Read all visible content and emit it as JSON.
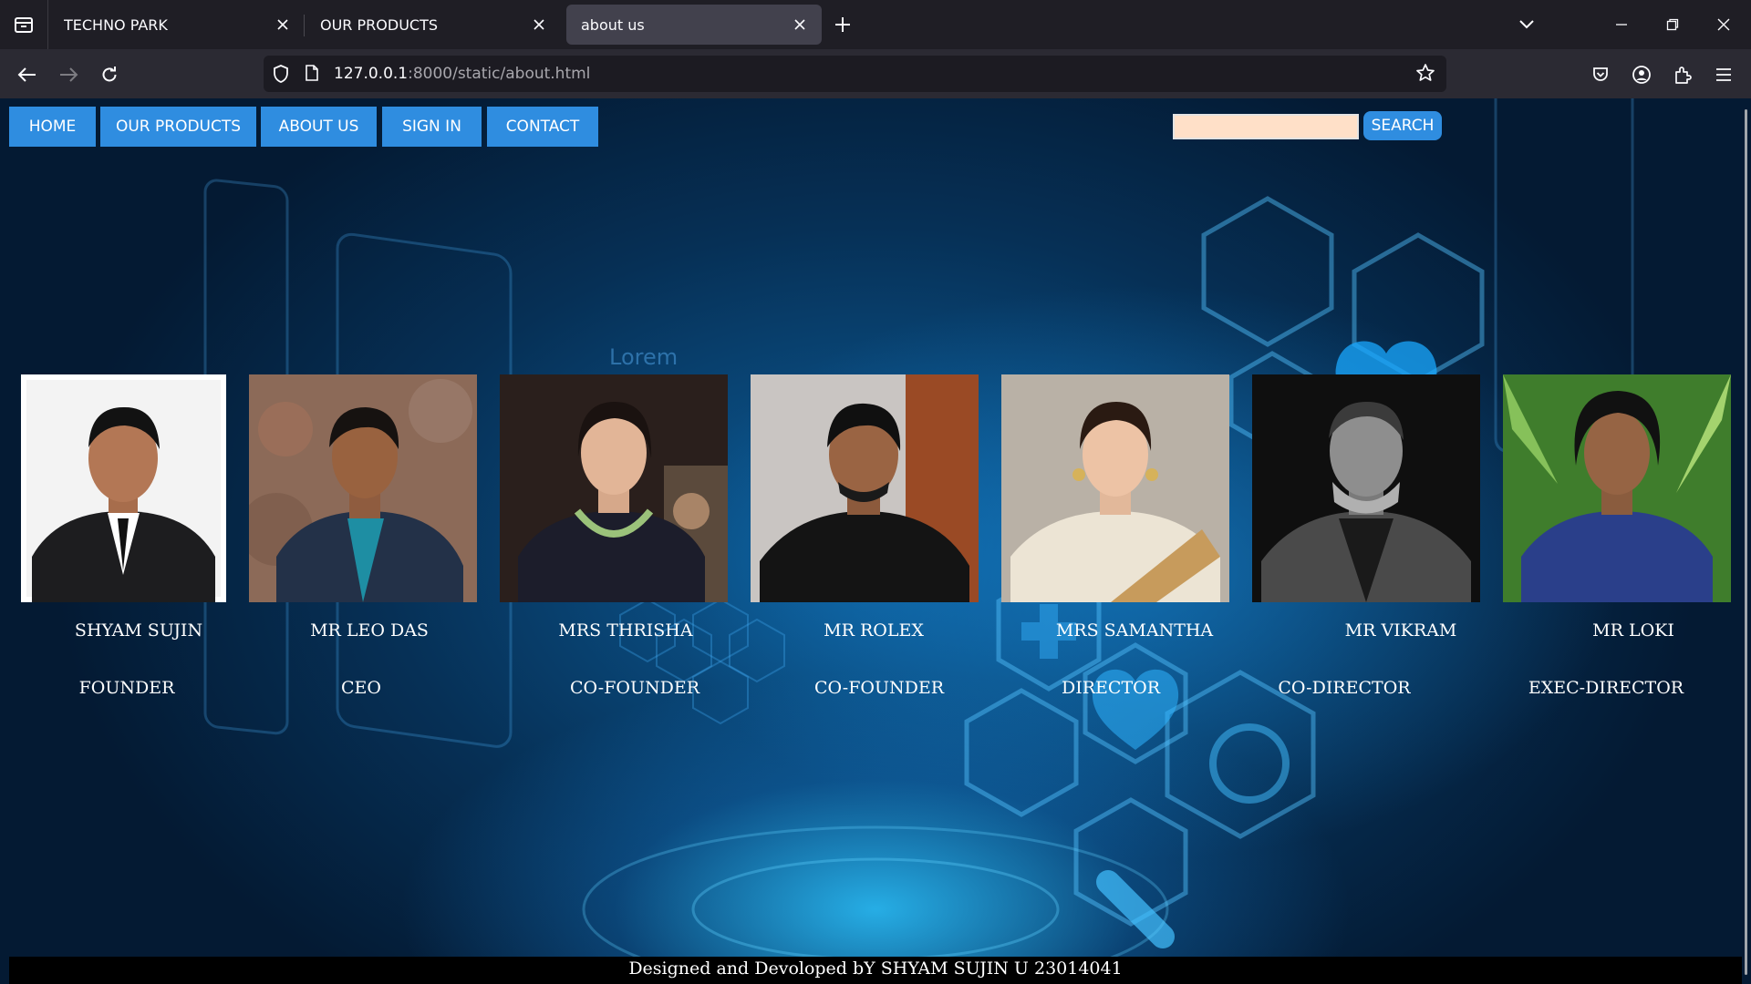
{
  "browser": {
    "tabs": [
      {
        "title": "TECHNO PARK",
        "active": false
      },
      {
        "title": "OUR PRODUCTS",
        "active": false
      },
      {
        "title": "about us",
        "active": true
      }
    ],
    "url_host": "127.0.0.1",
    "url_rest": ":8000/static/about.html"
  },
  "page": {
    "menu": [
      "HOME",
      "OUR PRODUCTS",
      "ABOUT US",
      "SIGN IN",
      "CONTACT"
    ],
    "search": {
      "value": "",
      "button": "SEARCH"
    },
    "background_text": "Lorem",
    "team": [
      {
        "name": "SHYAM SUJIN",
        "role": "FOUNDER"
      },
      {
        "name": "MR LEO DAS",
        "role": "CEO"
      },
      {
        "name": "MRS THRISHA",
        "role": "CO-FOUNDER"
      },
      {
        "name": "MR ROLEX",
        "role": "CO-FOUNDER"
      },
      {
        "name": "MRS SAMANTHA",
        "role": "DIRECTOR"
      },
      {
        "name": "MR VIKRAM",
        "role": "CO-DIRECTOR"
      },
      {
        "name": "MR LOKI",
        "role": "EXEC-DIRECTOR"
      }
    ],
    "footer": "Designed and Devoloped bY SHYAM SUJIN U 23014041"
  },
  "colors": {
    "menu_button": "#2f8de0",
    "search_input_bg": "#ffe0c8",
    "tabbar_bg": "#1f1e25",
    "toolbar_bg": "#2b2a33",
    "footer_bg": "#000000"
  }
}
